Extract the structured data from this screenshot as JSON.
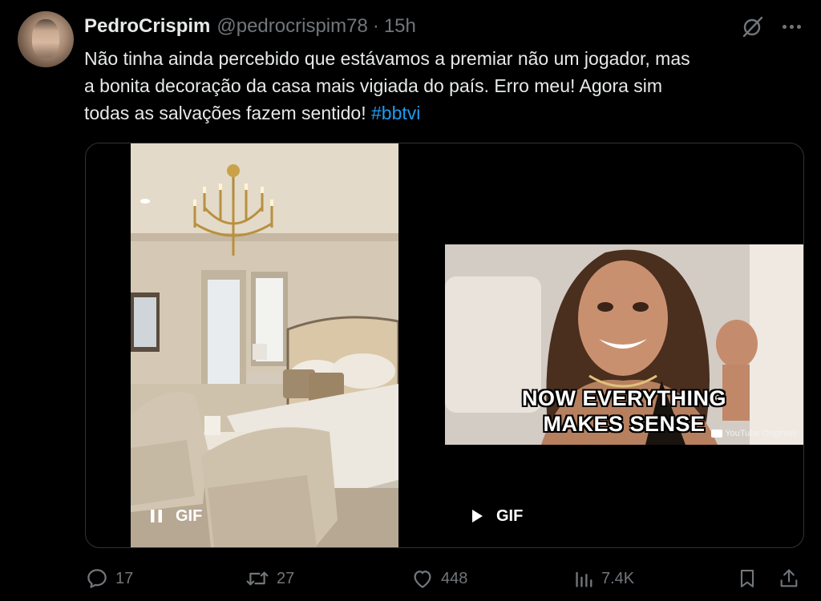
{
  "user": {
    "name": "PedroCrispim",
    "handle": "@pedrocrispim78",
    "separator": "·",
    "time": "15h"
  },
  "tweet": {
    "text_line1": "Não tinha ainda percebido que estávamos a premiar não um jogador,  mas",
    "text_line2": "a bonita decoração da casa mais vigiada do país. Erro meu! Agora sim",
    "text_line3": "todas as salvações fazem sentido! ",
    "hashtag": "#bbtvi"
  },
  "media": {
    "gif1": {
      "label": "GIF",
      "state": "playing"
    },
    "gif2": {
      "label": "GIF",
      "state": "paused",
      "caption_line1": "NOW EVERYTHING",
      "caption_line2": "MAKES SENSE",
      "watermark": "YouTube Originals"
    }
  },
  "actions": {
    "replies": "17",
    "retweets": "27",
    "likes": "448",
    "views": "7.4K"
  },
  "icons": {
    "grok": "grok-icon",
    "more": "more-icon",
    "reply": "reply-icon",
    "retweet": "retweet-icon",
    "like": "heart-icon",
    "views": "views-icon",
    "bookmark": "bookmark-icon",
    "share": "share-icon"
  },
  "colors": {
    "background": "#000000",
    "text": "#e7e9ea",
    "muted": "#71767b",
    "link": "#1d9bf0"
  }
}
